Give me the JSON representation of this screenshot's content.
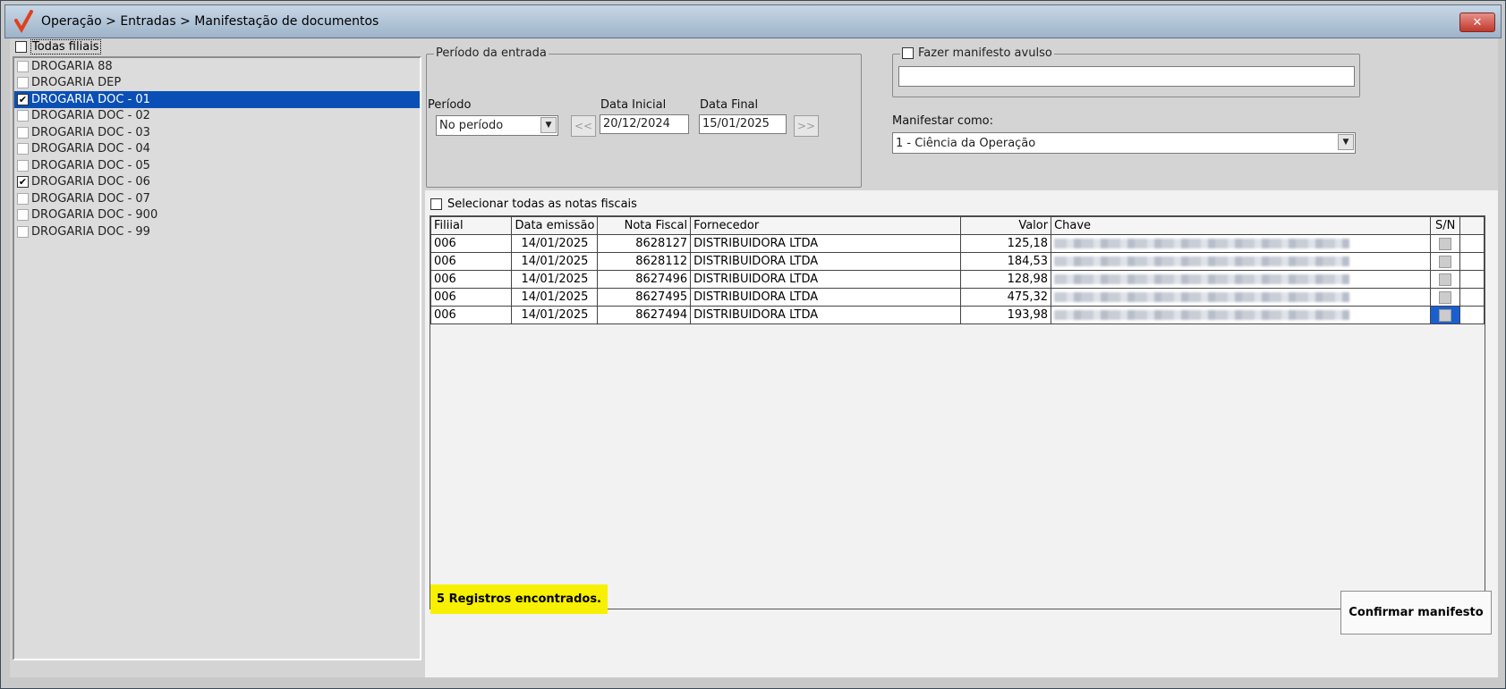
{
  "window": {
    "title": "Operação > Entradas > Manifestação de documentos",
    "close_label": "✕"
  },
  "branches": {
    "all_label": "Todas filiais",
    "items": [
      {
        "label": "DROGARIA 88",
        "checked": false,
        "selected": false
      },
      {
        "label": "DROGARIA DEP",
        "checked": false,
        "selected": false
      },
      {
        "label": "DROGARIA DOC - 01",
        "checked": true,
        "selected": true
      },
      {
        "label": "DROGARIA DOC - 02",
        "checked": false,
        "selected": false
      },
      {
        "label": "DROGARIA DOC - 03",
        "checked": false,
        "selected": false
      },
      {
        "label": "DROGARIA DOC - 04",
        "checked": false,
        "selected": false
      },
      {
        "label": "DROGARIA DOC - 05",
        "checked": false,
        "selected": false
      },
      {
        "label": "DROGARIA DOC - 06",
        "checked": true,
        "selected": false
      },
      {
        "label": "DROGARIA DOC - 07",
        "checked": false,
        "selected": false
      },
      {
        "label": "DROGARIA DOC - 900",
        "checked": false,
        "selected": false
      },
      {
        "label": "DROGARIA DOC - 99",
        "checked": false,
        "selected": false
      }
    ]
  },
  "period": {
    "group_label": "Período da entrada",
    "period_label": "Período",
    "period_value": "No período",
    "start_label": "Data Inicial",
    "start_value": "20/12/2024",
    "end_label": "Data Final",
    "end_value": "15/01/2025",
    "prev_label": "<<",
    "next_label": ">>"
  },
  "manifest": {
    "avulso_label": "Fazer manifesto avulso",
    "avulso_value": "",
    "as_label": "Manifestar como:",
    "as_value": "1 - Ciência da Operação"
  },
  "grid": {
    "select_all_label": "Selecionar todas as notas fiscais",
    "columns": [
      "Filiial",
      "Data emissão",
      "Nota Fiscal",
      "Fornecedor",
      "Valor",
      "Chave",
      "S/N"
    ],
    "rows": [
      {
        "filial": "006",
        "data": "14/01/2025",
        "nota": "8628127",
        "fornecedor": "DISTRIBUIDORA  LTDA",
        "valor": "125,18"
      },
      {
        "filial": "006",
        "data": "14/01/2025",
        "nota": "8628112",
        "fornecedor": "DISTRIBUIDORA  LTDA",
        "valor": "184,53"
      },
      {
        "filial": "006",
        "data": "14/01/2025",
        "nota": "8627496",
        "fornecedor": "DISTRIBUIDORA  LTDA",
        "valor": "128,98"
      },
      {
        "filial": "006",
        "data": "14/01/2025",
        "nota": "8627495",
        "fornecedor": "DISTRIBUIDORA  LTDA",
        "valor": "475,32"
      },
      {
        "filial": "006",
        "data": "14/01/2025",
        "nota": "8627494",
        "fornecedor": "DISTRIBUIDORA  LTDA",
        "valor": "193,98"
      }
    ]
  },
  "status": {
    "text": "5 Registros encontrados."
  },
  "actions": {
    "confirm_label": "Confirmar manifesto"
  },
  "colors": {
    "selection": "#0a4fb5",
    "status_bg": "#f7f000",
    "title_gradient_top": "#c6d6e6"
  }
}
